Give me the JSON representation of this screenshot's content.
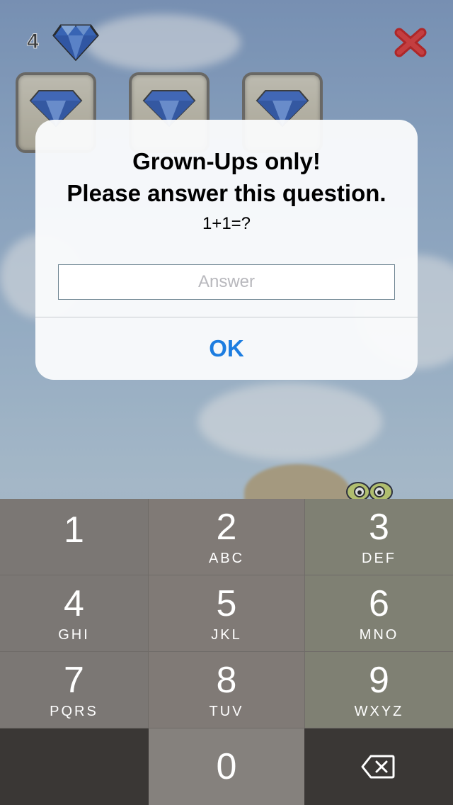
{
  "hud": {
    "gem_count": "4",
    "gem_icon": "diamond-icon",
    "close_icon": "close-icon",
    "close_color": "#c51717"
  },
  "tiles": [
    {
      "icon": "diamond-icon"
    },
    {
      "icon": "diamond-icon"
    },
    {
      "icon": "diamond-icon"
    }
  ],
  "alert": {
    "title_line1": "Grown-Ups only!",
    "title_line2": "Please answer this question.",
    "message": "1+1=?",
    "input_value": "",
    "input_placeholder": "Answer",
    "ok_label": "OK",
    "ok_color": "#1d7de0"
  },
  "keypad": {
    "keys": [
      {
        "num": "1",
        "letters": ""
      },
      {
        "num": "2",
        "letters": "ABC"
      },
      {
        "num": "3",
        "letters": "DEF"
      },
      {
        "num": "4",
        "letters": "GHI"
      },
      {
        "num": "5",
        "letters": "JKL"
      },
      {
        "num": "6",
        "letters": "MNO"
      },
      {
        "num": "7",
        "letters": "PQRS"
      },
      {
        "num": "8",
        "letters": "TUV"
      },
      {
        "num": "9",
        "letters": "WXYZ"
      },
      {
        "num": "0",
        "letters": ""
      }
    ],
    "delete_icon": "backspace-icon"
  }
}
